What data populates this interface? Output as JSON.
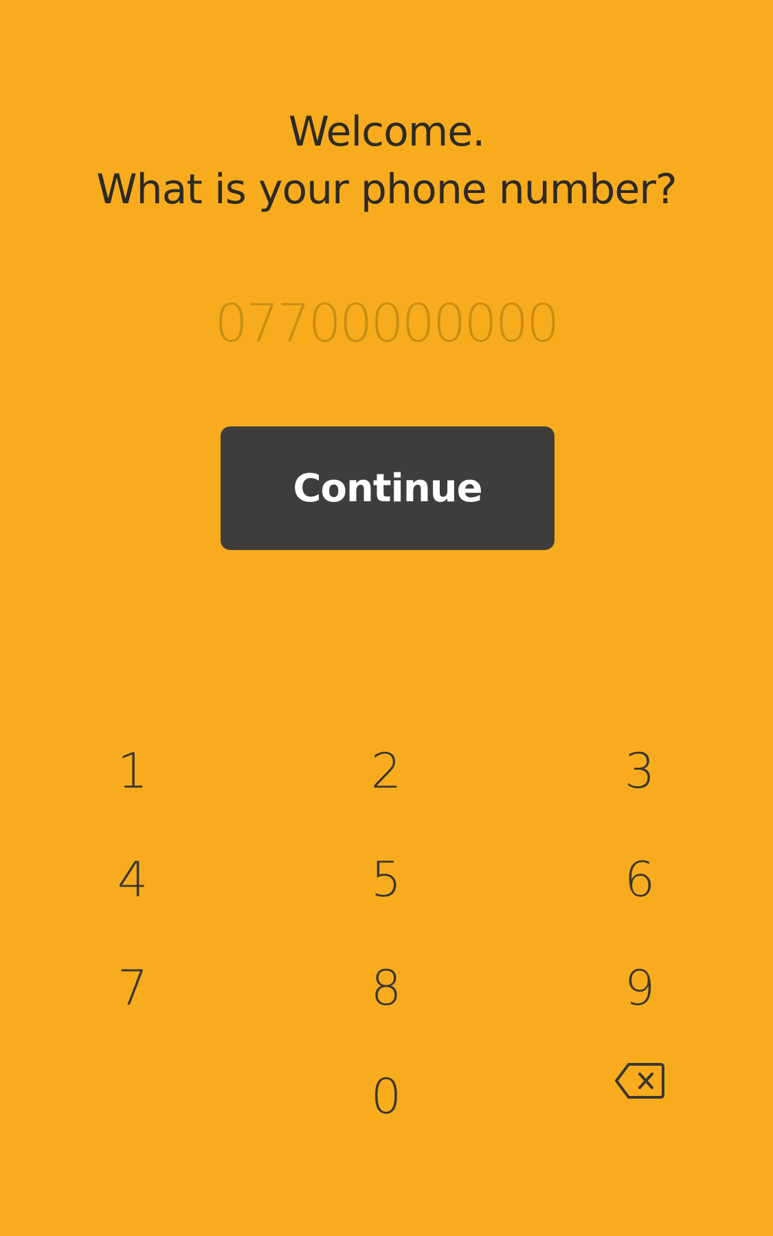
{
  "header": {
    "line1": "Welcome.",
    "line2": "What is your phone number?"
  },
  "phone_input": {
    "placeholder": "07700000000",
    "value": ""
  },
  "continue_button": {
    "label": "Continue"
  },
  "keypad": {
    "keys": [
      "1",
      "2",
      "3",
      "4",
      "5",
      "6",
      "7",
      "8",
      "9",
      "0"
    ],
    "backspace_icon": "backspace-icon"
  },
  "colors": {
    "background": "#F8AC1D",
    "button": "#3E3D3C",
    "button_text": "#FFFFFF",
    "text": "#2D2A24",
    "placeholder": "#C98D12"
  }
}
